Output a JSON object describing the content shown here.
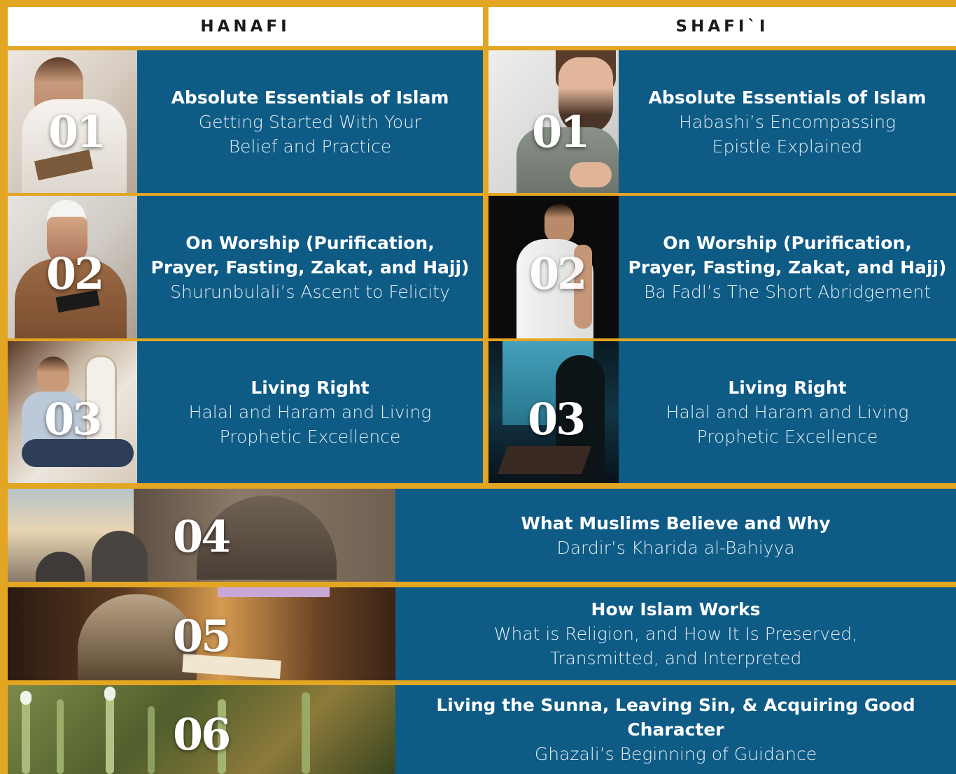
{
  "headers": {
    "left": "HANAFI",
    "right": "SHAFI`I"
  },
  "colors": {
    "frame": "#e3a623",
    "card": "#0e5b86",
    "text": "#ffffff"
  },
  "left_cards": [
    {
      "number": "01",
      "title": "Absolute Essentials of Islam",
      "sub1": "Getting Started With Your",
      "sub2": "Belief and Practice"
    },
    {
      "number": "02",
      "title": "On Worship (Purification,",
      "title2": "Prayer, Fasting, Zakat, and Hajj)",
      "sub1": "Shurunbulali’s Ascent to Felicity"
    },
    {
      "number": "03",
      "title": "Living Right",
      "sub1": "Halal and Haram and Living",
      "sub2": "Prophetic Excellence"
    }
  ],
  "right_cards": [
    {
      "number": "01",
      "title": "Absolute Essentials of Islam",
      "sub1": "Habashi’s Encompassing",
      "sub2": "Epistle Explained"
    },
    {
      "number": "02",
      "title": "On Worship (Purification,",
      "title2": "Prayer, Fasting, Zakat, and Hajj)",
      "sub1": "Ba Fadl’s The Short Abridgement"
    },
    {
      "number": "03",
      "title": "Living Right",
      "sub1": "Halal and Haram and Living",
      "sub2": "Prophetic Excellence"
    }
  ],
  "wide_cards": [
    {
      "number": "04",
      "title": "What Muslims Believe and Why",
      "sub1": "Dardir’s Kharida al-Bahiyya"
    },
    {
      "number": "05",
      "title": "How Islam Works",
      "sub1": "What is Religion, and How It Is Preserved,",
      "sub2": "Transmitted, and Interpreted"
    },
    {
      "number": "06",
      "title": "Living the Sunna, Leaving Sin, & Acquiring Good Character",
      "sub1": "Ghazali’s Beginning of Guidance"
    }
  ]
}
